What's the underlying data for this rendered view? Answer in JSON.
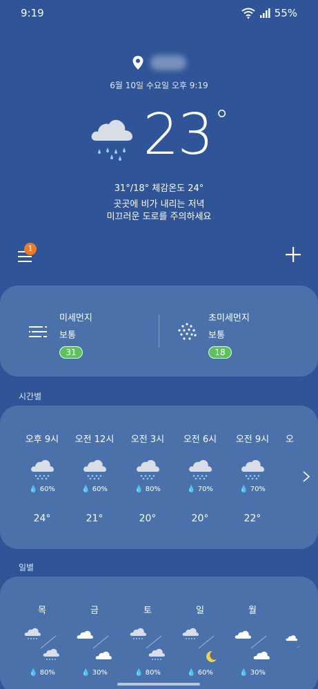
{
  "status_bar": {
    "time": "9:19",
    "battery": "55%"
  },
  "current": {
    "datetime": "6월 10일 수요일 오후 9:19",
    "temperature": "23",
    "degree_symbol": "°",
    "minmax_feels": "31°/18° 체감온도 24°",
    "description_line1": "곳곳에 비가 내리는 저녁",
    "description_line2": "미끄러운 도로를 주의하세요",
    "icon": "rain-cloud-icon"
  },
  "toolbar": {
    "menu_badge": "1",
    "menu_icon": "menu-icon",
    "add_icon": "plus-icon"
  },
  "dust": {
    "fine": {
      "title": "미세먼지",
      "status": "보통",
      "value": "31"
    },
    "ultrafine": {
      "title": "초미세먼지",
      "status": "보통",
      "value": "18"
    }
  },
  "hourly": {
    "label": "시간별",
    "items": [
      {
        "time": "오후 9시",
        "pop": "60%",
        "temp": "24°",
        "icon": "rain-cloud-icon"
      },
      {
        "time": "오전 12시",
        "pop": "60%",
        "temp": "21°",
        "icon": "rain-cloud-icon"
      },
      {
        "time": "오전 3시",
        "pop": "80%",
        "temp": "20°",
        "icon": "rain-cloud-icon"
      },
      {
        "time": "오전 6시",
        "pop": "70%",
        "temp": "20°",
        "icon": "rain-cloud-icon"
      },
      {
        "time": "오전 9시",
        "pop": "70%",
        "temp": "22°",
        "icon": "rain-cloud-icon"
      },
      {
        "time": "오",
        "pop": "",
        "temp": "",
        "icon": "rain-cloud-icon"
      }
    ]
  },
  "daily": {
    "label": "일별",
    "items": [
      {
        "day": "목",
        "pop": "80%",
        "am_icon": "rain-cloud-icon",
        "pm_icon": "rain-cloud-icon"
      },
      {
        "day": "금",
        "pop": "30%",
        "am_icon": "cloud-icon",
        "pm_icon": "cloud-icon"
      },
      {
        "day": "토",
        "pop": "80%",
        "am_icon": "rain-cloud-icon",
        "pm_icon": "rain-cloud-icon"
      },
      {
        "day": "일",
        "pop": "60%",
        "am_icon": "rain-cloud-icon",
        "pm_icon": "moon-icon"
      },
      {
        "day": "월",
        "pop": "30%",
        "am_icon": "cloud-icon",
        "pm_icon": "cloud-icon"
      }
    ]
  },
  "colors": {
    "background": "#2f5598",
    "card": "#4b71aa",
    "badge_good": "#5cc35b",
    "notification": "#f07a22",
    "raindrop": "#8fd4f5"
  }
}
